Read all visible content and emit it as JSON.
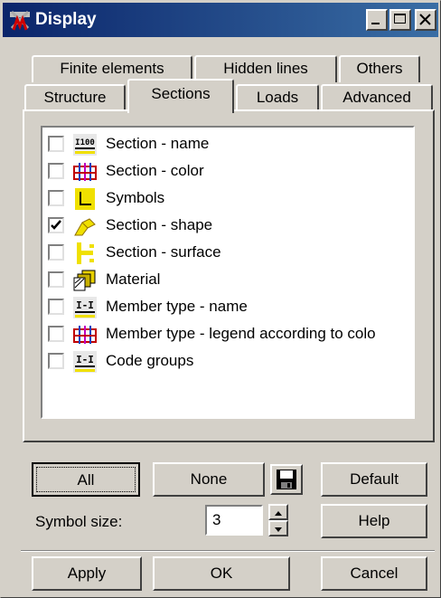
{
  "window": {
    "title": "Display"
  },
  "tabs": {
    "back_row": [
      "Finite elements",
      "Hidden lines",
      "Others"
    ],
    "front_row": [
      "Structure",
      "Sections",
      "Loads",
      "Advanced"
    ],
    "active": "Sections"
  },
  "list": {
    "items": [
      {
        "label": "Section - name",
        "checked": false,
        "icon": "section-name-icon"
      },
      {
        "label": "Section - color",
        "checked": false,
        "icon": "section-color-icon"
      },
      {
        "label": "Symbols",
        "checked": false,
        "icon": "symbols-icon"
      },
      {
        "label": "Section - shape",
        "checked": true,
        "icon": "section-shape-icon"
      },
      {
        "label": "Section - surface",
        "checked": false,
        "icon": "section-surface-icon"
      },
      {
        "label": "Material",
        "checked": false,
        "icon": "material-icon"
      },
      {
        "label": "Member type - name",
        "checked": false,
        "icon": "member-type-name-icon"
      },
      {
        "label": "Member type - legend according to colo",
        "checked": false,
        "icon": "member-type-legend-icon"
      },
      {
        "label": "Code groups",
        "checked": false,
        "icon": "code-groups-icon"
      }
    ],
    "icon_text": {
      "section_name": "I100",
      "member_type": "I-I"
    }
  },
  "buttons": {
    "all": "All",
    "none": "None",
    "default": "Default",
    "help": "Help",
    "apply": "Apply",
    "ok": "OK",
    "cancel": "Cancel"
  },
  "symbol_size": {
    "label": "Symbol size:",
    "value": "3"
  },
  "colors": {
    "title_start": "#0a246a",
    "title_end": "#3a6ea5",
    "face": "#d4d0c8",
    "icon_yellow": "#f0e000"
  }
}
